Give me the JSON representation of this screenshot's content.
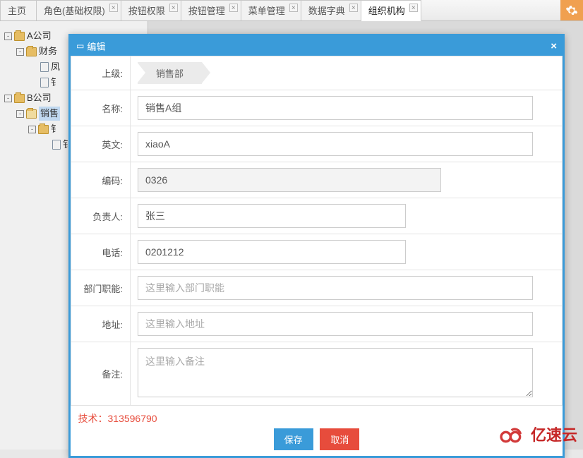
{
  "tabs": [
    {
      "label": "主页",
      "closable": false
    },
    {
      "label": "角色(基础权限)",
      "closable": true
    },
    {
      "label": "按钮权限",
      "closable": true
    },
    {
      "label": "按钮管理",
      "closable": true
    },
    {
      "label": "菜单管理",
      "closable": true
    },
    {
      "label": "数据字典",
      "closable": true
    },
    {
      "label": "组织机构",
      "closable": true,
      "active": true
    }
  ],
  "tree": {
    "companyA": "A公司",
    "finance": "财务",
    "fin_child1": "凤",
    "fin_child2": "钅",
    "companyB": "B公司",
    "sales": "销售",
    "sales_child1": "钅",
    "sales_child2": "钅"
  },
  "dialog": {
    "title": "编辑",
    "labels": {
      "parent": "上级:",
      "name": "名称:",
      "english": "英文:",
      "code": "编码:",
      "owner": "负责人:",
      "phone": "电话:",
      "duty": "部门职能:",
      "address": "地址:",
      "remark": "备注:"
    },
    "values": {
      "parent": "销售部",
      "name": "销售A组",
      "english": "xiaoA",
      "code": "0326",
      "owner": "张三",
      "phone": "0201212"
    },
    "placeholders": {
      "duty": "这里输入部门职能",
      "address": "这里输入地址",
      "remark": "这里输入备注"
    },
    "tech_label": "技术：",
    "tech_value": "313596790",
    "buttons": {
      "save": "保存",
      "cancel": "取消"
    }
  },
  "watermark": "亿速云"
}
